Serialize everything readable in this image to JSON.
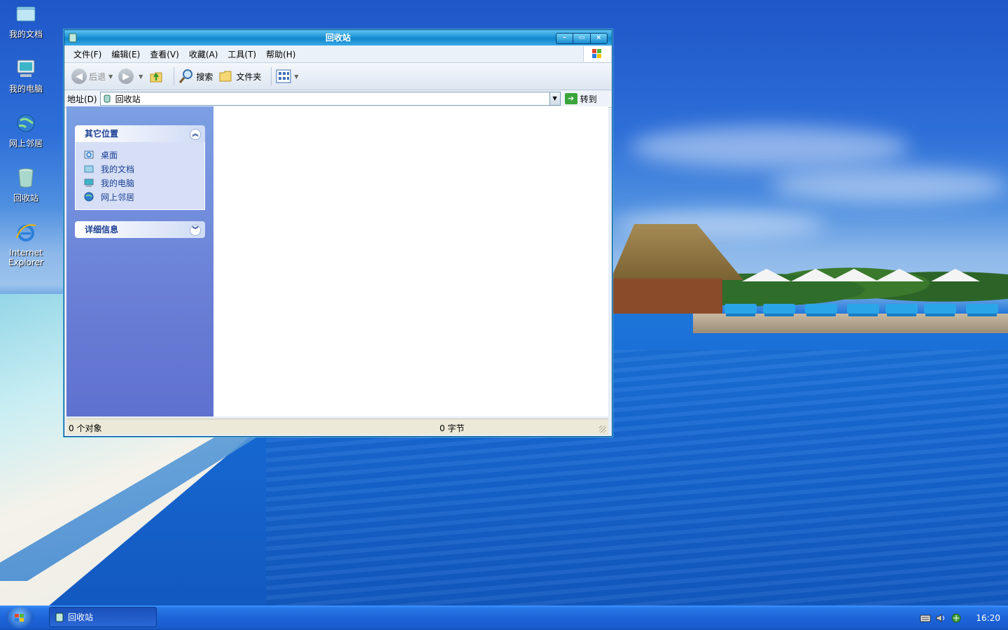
{
  "desktop": {
    "icons": [
      {
        "label": "我的文档",
        "icon": "documents-icon"
      },
      {
        "label": "我的电脑",
        "icon": "computer-icon"
      },
      {
        "label": "网上邻居",
        "icon": "network-icon"
      },
      {
        "label": "回收站",
        "icon": "recycle-bin-icon"
      },
      {
        "label_line1": "Internet",
        "label_line2": "Explorer",
        "icon": "internet-explorer-icon"
      }
    ]
  },
  "window": {
    "title": "回收站",
    "controls": {
      "minimize": "–",
      "maximize": "▭",
      "close": "×"
    },
    "menu": [
      "文件(F)",
      "编辑(E)",
      "查看(V)",
      "收藏(A)",
      "工具(T)",
      "帮助(H)"
    ],
    "toolbar": {
      "back_label": "后退",
      "search_label": "搜索",
      "folders_label": "文件夹"
    },
    "address": {
      "label": "地址(D)",
      "value": "回收站",
      "go_label": "转到"
    },
    "tasks": {
      "other_places": {
        "title": "其它位置",
        "links": [
          "桌面",
          "我的文档",
          "我的电脑",
          "网上邻居"
        ]
      },
      "details": {
        "title": "详细信息"
      }
    },
    "status": {
      "objects": "0 个对象",
      "size": "0 字节"
    }
  },
  "taskbar": {
    "active_task": "回收站",
    "clock": "16:20"
  },
  "colors": {
    "title_blue": "#1e93d6",
    "task_pane": "#6a7fd6",
    "link_blue": "#1c3f94",
    "taskbar_blue": "#1c64d8"
  }
}
